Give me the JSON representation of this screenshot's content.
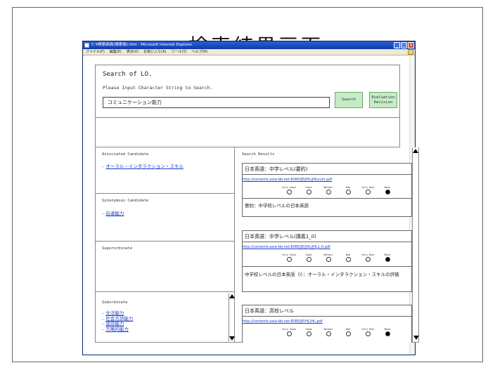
{
  "slide": {
    "title": "検索結果画面"
  },
  "window": {
    "title": "C:¥検索画面(検索後).htm - Microsoft Internet Explorer",
    "controls": {
      "minimize": "_",
      "maximize": "□",
      "close": "X"
    },
    "menu": [
      "ファイル(F)",
      "編集(E)",
      "表示(V)",
      "お気に入り(A)",
      "ツール(T)",
      "ヘルプ(H)"
    ]
  },
  "search": {
    "heading": "Search of LO.",
    "prompt": "Please Input Character String to Search.",
    "value": "コミュニケーション能力",
    "search_label": "Search",
    "eval_label_1": "Evaluation",
    "eval_label_2": "Decision"
  },
  "associated": {
    "title": "Associated Candidate",
    "items": [
      "オーラル・インタラクション・スキル"
    ]
  },
  "synonymous": {
    "title": "Synonymous Candidate",
    "items": [
      "伝達能力"
    ]
  },
  "superordinate": {
    "title": "Superordinate"
  },
  "subordinate": {
    "title": "Subordinate",
    "items": [
      "文法能力",
      "社会言語能力",
      "談話能力",
      "方略的能力"
    ]
  },
  "results": {
    "title": "Search Results",
    "rating_labels": [
      "Very Good",
      "Good",
      "Normal",
      "Bad",
      "Very Bad",
      "None"
    ],
    "items": [
      {
        "title": "日本英語：中学レベル(要約)",
        "url": "http://contents.asia-bb.net:8080/JE/JHL/JHLsum.pdf",
        "selected": "None",
        "desc": "要約：中学校レベルの日本英語"
      },
      {
        "title": "日本英語：中学レベル(講義1_0)",
        "url": "http://contents.asia-bb.net:8080/JE/JHL/JHL1-0.pdf",
        "selected": "None",
        "desc": "中学校レベルの日本英語（I）：オーラル・インタラクション・スキルの評価"
      },
      {
        "title": "日本英語：高校レベル",
        "url": "http://contents.asia-bb.net:8080/JE/HL/HL.pdf",
        "selected": "None"
      }
    ]
  }
}
